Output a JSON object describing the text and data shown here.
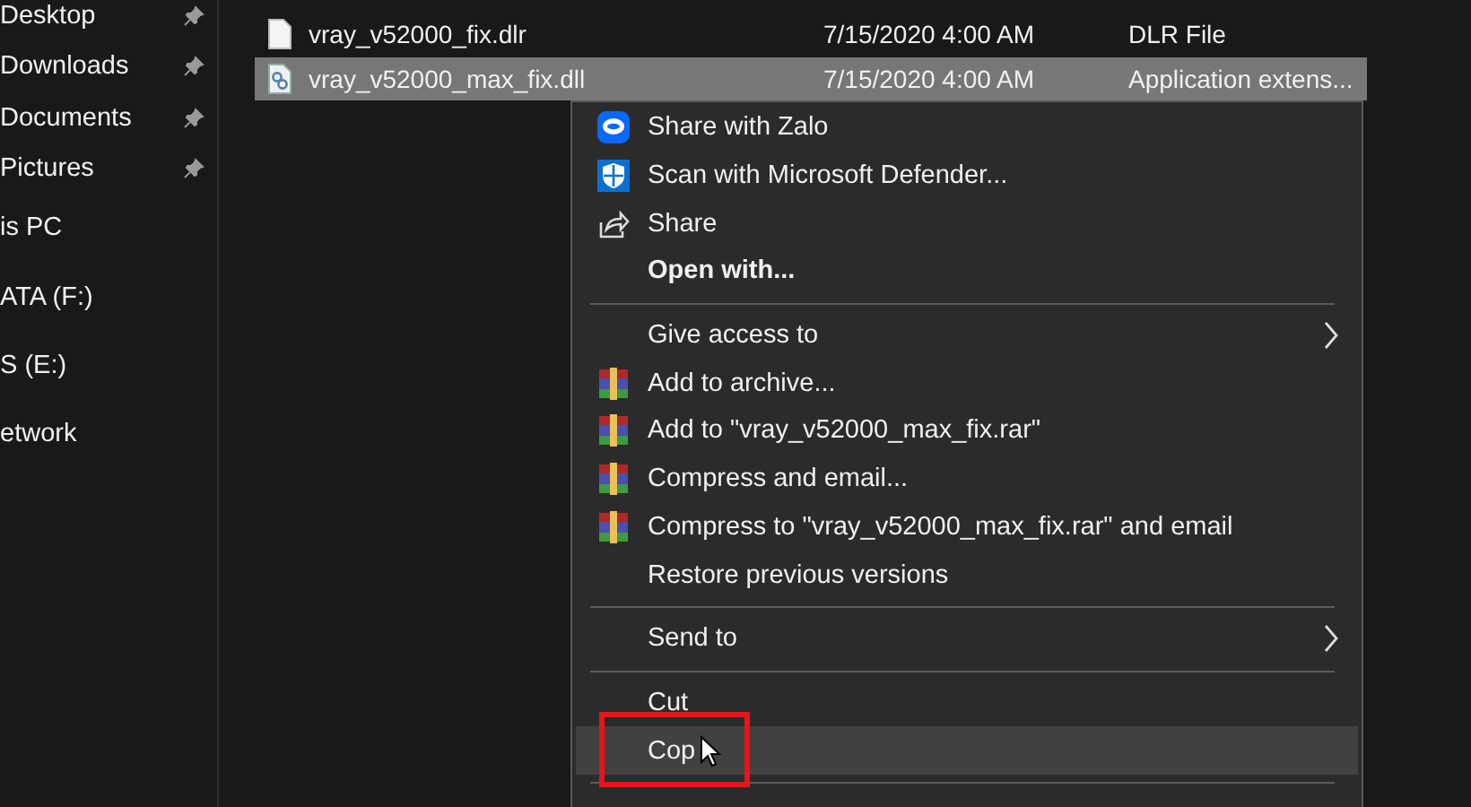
{
  "sidebar": {
    "items": [
      {
        "label": "Desktop",
        "pinned": true
      },
      {
        "label": "Downloads",
        "pinned": true
      },
      {
        "label": "Documents",
        "pinned": true
      },
      {
        "label": "Pictures",
        "pinned": true
      },
      {
        "label": "is PC",
        "pinned": false
      },
      {
        "label": "ATA (F:)",
        "pinned": false
      },
      {
        "label": "S (E:)",
        "pinned": false
      },
      {
        "label": "etwork",
        "pinned": false
      }
    ]
  },
  "files": {
    "rows": [
      {
        "kind": "document",
        "name": "vray_v52000_fix.dlr",
        "date": "7/15/2020 4:00 AM",
        "type": "DLR File",
        "selected": false
      },
      {
        "kind": "library",
        "name": "vray_v52000_max_fix.dll",
        "date": "7/15/2020 4:00 AM",
        "type": "Application extens...",
        "selected": true
      }
    ]
  },
  "context_menu": {
    "items": [
      {
        "kind": "messenger",
        "label": "Share with Zalo",
        "bold": false,
        "submenu": false,
        "highlighted": false
      },
      {
        "kind": "defender",
        "label": "Scan with Microsoft Defender...",
        "bold": false,
        "submenu": false,
        "highlighted": false
      },
      {
        "kind": "share",
        "label": "Share",
        "bold": false,
        "submenu": false,
        "highlighted": false
      },
      {
        "kind": "plain",
        "label": "Open with...",
        "bold": true,
        "submenu": false,
        "highlighted": false
      },
      {
        "kind": "separator"
      },
      {
        "kind": "plain",
        "label": "Give access to",
        "bold": false,
        "submenu": true,
        "highlighted": false
      },
      {
        "kind": "archive",
        "label": "Add to archive...",
        "bold": false,
        "submenu": false,
        "highlighted": false
      },
      {
        "kind": "archive",
        "label": "Add to \"vray_v52000_max_fix.rar\"",
        "bold": false,
        "submenu": false,
        "highlighted": false
      },
      {
        "kind": "archive",
        "label": "Compress and email...",
        "bold": false,
        "submenu": false,
        "highlighted": false
      },
      {
        "kind": "archive",
        "label": "Compress to \"vray_v52000_max_fix.rar\" and email",
        "bold": false,
        "submenu": false,
        "highlighted": false
      },
      {
        "kind": "plain",
        "label": "Restore previous versions",
        "bold": false,
        "submenu": false,
        "highlighted": false
      },
      {
        "kind": "separator"
      },
      {
        "kind": "plain",
        "label": "Send to",
        "bold": false,
        "submenu": true,
        "highlighted": false
      },
      {
        "kind": "separator"
      },
      {
        "kind": "plain",
        "label": "Cut",
        "bold": false,
        "submenu": false,
        "highlighted": false
      },
      {
        "kind": "plain",
        "label": "Cop",
        "bold": false,
        "submenu": false,
        "highlighted": true,
        "annotated": true
      },
      {
        "kind": "separator"
      }
    ]
  }
}
